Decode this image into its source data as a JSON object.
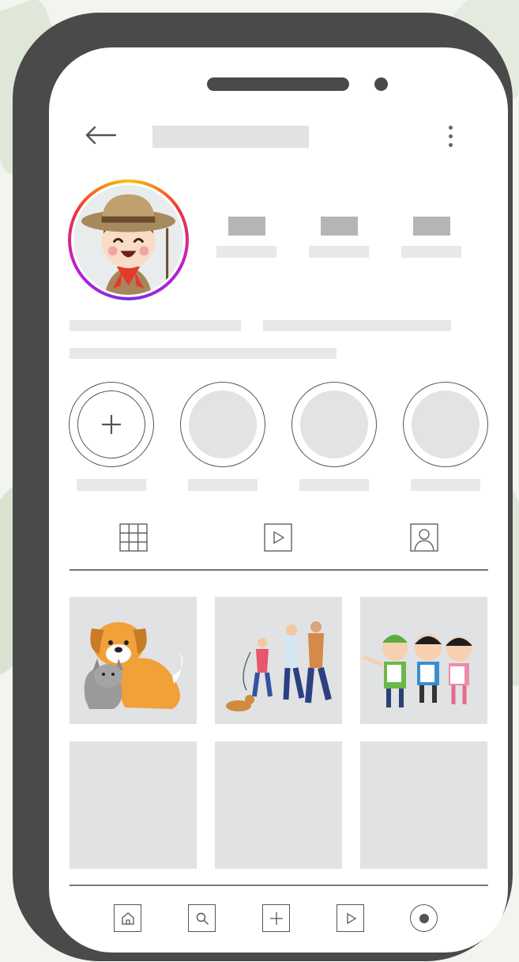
{
  "icons": {
    "back": "arrow-left-icon",
    "menu": "vertical-ellipsis-icon",
    "new_highlight": "plus-icon",
    "tab_grid": "grid-icon",
    "tab_reels": "play-icon",
    "tab_tagged": "person-icon",
    "nav_home": "home-icon",
    "nav_search": "search-icon",
    "nav_create": "plus-icon",
    "nav_reels": "play-icon",
    "nav_profile": "profile-icon"
  },
  "colors": {
    "phone_frame": "#4a4a4a",
    "screen": "#ffffff",
    "placeholder": "#e0e2e3",
    "placeholder_dark": "#b5b5b5",
    "story_ring": [
      "#f7c500",
      "#f2333c",
      "#b91fd6",
      "#7a2ee0"
    ]
  },
  "posts": [
    {
      "image": "dog-and-cat-illustration"
    },
    {
      "image": "family-walking-dog-illustration"
    },
    {
      "image": "children-scouts-illustration"
    },
    {
      "image": "empty"
    },
    {
      "image": "empty"
    },
    {
      "image": "empty"
    }
  ]
}
